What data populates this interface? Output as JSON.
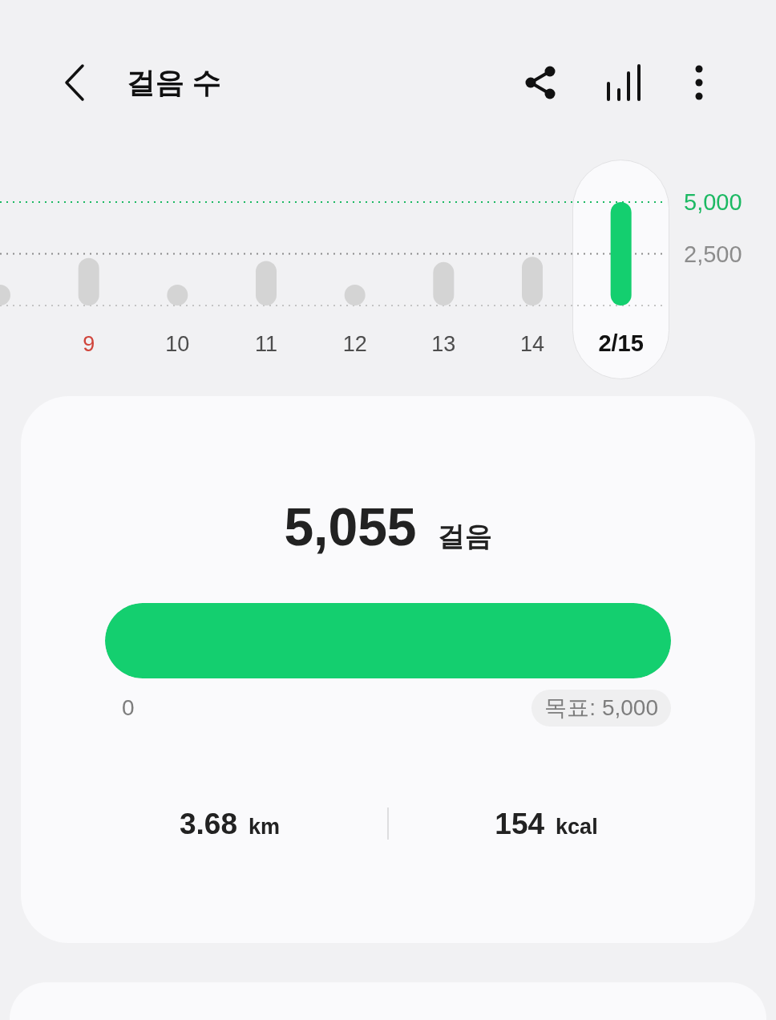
{
  "header": {
    "title": "걸음 수"
  },
  "chart": {
    "chart_data": {
      "type": "bar",
      "x": [
        8,
        9,
        10,
        11,
        12,
        13,
        14,
        15
      ],
      "series": [
        {
          "color": "#d4d4d4",
          "values": [
            1000,
            2300,
            1000,
            2150,
            1000,
            2100,
            2350,
            null
          ]
        },
        {
          "color": "#14cf6f",
          "values": [
            null,
            null,
            null,
            null,
            null,
            null,
            null,
            5000
          ]
        }
      ],
      "stacked": true,
      "xlim": [
        8,
        15.5
      ],
      "ylim": [
        0,
        5000
      ],
      "xticks": [
        {
          "value": 9,
          "label": "9"
        },
        {
          "value": 10,
          "label": "10"
        },
        {
          "value": 11,
          "label": "11"
        },
        {
          "value": 12,
          "label": "12"
        },
        {
          "value": 13,
          "label": "13"
        },
        {
          "value": 14,
          "label": "14"
        },
        {
          "value": 15,
          "label": "2/15"
        }
      ],
      "yticks": [
        {
          "value": 2500,
          "label": "2,500"
        },
        {
          "value": 5000,
          "label": "5,000"
        }
      ],
      "ref_lines": [
        {
          "axis": "y",
          "value": 2500,
          "color": "#8c8c8c"
        },
        {
          "axis": "y",
          "value": 5000,
          "color": "#1cb963"
        }
      ]
    },
    "days": [
      {
        "selected": false,
        "color": "#d0443a"
      },
      {
        "selected": false,
        "color": "#4d4d4d"
      },
      {
        "selected": false,
        "color": "#4d4d4d"
      },
      {
        "selected": false,
        "color": "#4d4d4d"
      },
      {
        "selected": false,
        "color": "#4d4d4d"
      },
      {
        "selected": false,
        "color": "#4d4d4d"
      },
      {
        "selected": true,
        "color": "#111111"
      }
    ]
  },
  "total": {
    "value": "5,055",
    "unit": "걸음"
  },
  "progress": {
    "level": 1,
    "min_label": "0",
    "goal_label": "목표: 5,000"
  },
  "stats": [
    {
      "value": "3.68",
      "unit": "km"
    },
    {
      "value": "154",
      "unit": "kcal"
    }
  ]
}
